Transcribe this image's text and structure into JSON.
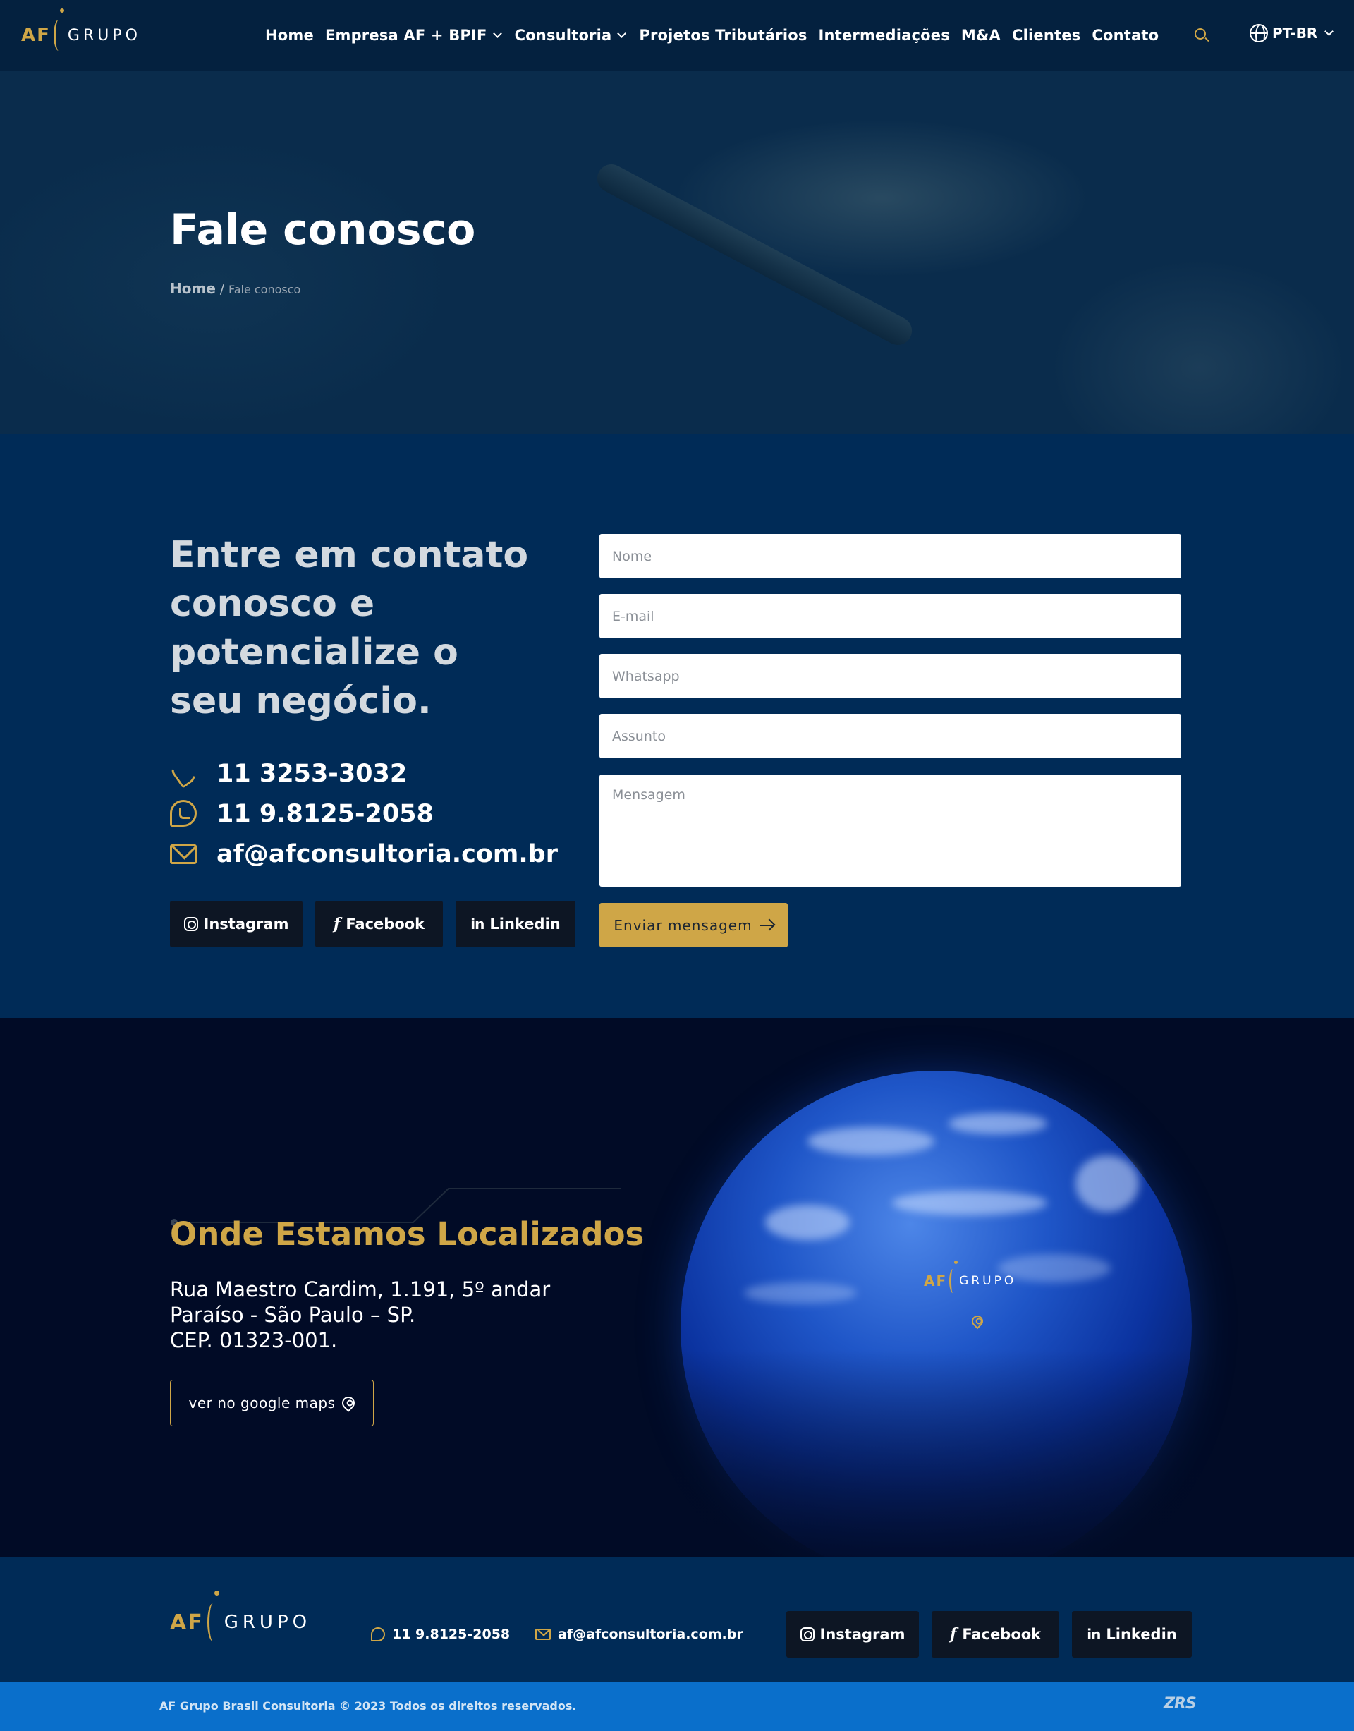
{
  "brand": {
    "af": "AF",
    "grupo": "GRUPO"
  },
  "colors": {
    "gold": "#cfa647",
    "navy": "#002b57",
    "dark": "#010b26",
    "footer_bar": "#0a6fcb"
  },
  "nav": {
    "items": [
      {
        "label": "Home"
      },
      {
        "label": "Empresa AF + BPIF",
        "dropdown": true
      },
      {
        "label": "Consultoria",
        "dropdown": true
      },
      {
        "label": "Projetos Tributários"
      },
      {
        "label": "Intermediações"
      },
      {
        "label": "M&A"
      },
      {
        "label": "Clientes"
      },
      {
        "label": "Contato"
      }
    ],
    "search_icon": "search-icon",
    "language": "PT-BR"
  },
  "hero": {
    "title": "Fale conosco",
    "breadcrumb": {
      "home": "Home",
      "separator": "/",
      "current": "Fale conosco"
    }
  },
  "contact": {
    "heading": "Entre em contato conosco e potencialize o seu negócio.",
    "phone": "11 3253-3032",
    "whatsapp": "11 9.8125-2058",
    "email": "af@afconsultoria.com.br",
    "social": {
      "instagram": "Instagram",
      "facebook": "Facebook",
      "linkedin": "Linkedin"
    },
    "form": {
      "name_placeholder": "Nome",
      "email_placeholder": "E-mail",
      "whatsapp_placeholder": "Whatsapp",
      "subject_placeholder": "Assunto",
      "message_placeholder": "Mensagem",
      "submit_label": "Enviar mensagem"
    }
  },
  "location": {
    "title": "Onde Estamos Localizados",
    "address_line1": "Rua Maestro Cardim, 1.191, 5º andar",
    "address_line2": "Paraíso - São Paulo – SP.",
    "address_line3": "CEP. 01323-001.",
    "maps_button": "ver no google maps"
  },
  "footer": {
    "whatsapp": "11 9.8125-2058",
    "email": "af@afconsultoria.com.br",
    "social": {
      "instagram": "Instagram",
      "facebook": "Facebook",
      "linkedin": "Linkedin"
    },
    "copyright": "AF Grupo Brasil Consultoria © 2023 Todos os direitos reservados.",
    "developer_logo": "ZRS"
  }
}
